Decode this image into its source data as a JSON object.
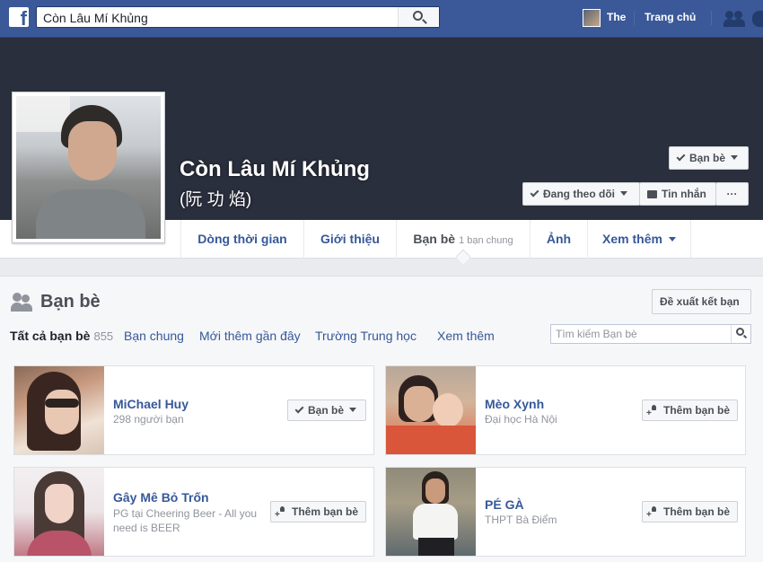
{
  "topbar": {
    "search_value": "Còn Lâu Mí Khủng",
    "user_name": "The",
    "home_label": "Trang chủ"
  },
  "profile": {
    "name": "Còn Lâu Mí Khủng",
    "alternate_name": "(阮 功 焰)",
    "friend_button": "Bạn bè",
    "following_button": "Đang theo dõi",
    "message_button": "Tin nhắn",
    "more_button": "···"
  },
  "tabs": [
    {
      "label": "Dòng thời gian"
    },
    {
      "label": "Giới thiệu"
    },
    {
      "label": "Bạn bè",
      "sub": "1 bạn chung"
    },
    {
      "label": "Ảnh"
    },
    {
      "label": "Xem thêm"
    }
  ],
  "friends_panel": {
    "title": "Bạn bè",
    "suggest_button": "Đề xuất kết bạn",
    "subnav": [
      {
        "label": "Tất cả bạn bè",
        "count": "855"
      },
      {
        "label": "Bạn chung"
      },
      {
        "label": "Mới thêm gần đây"
      },
      {
        "label": "Trường Trung học"
      },
      {
        "label": "Xem thêm"
      }
    ],
    "search_placeholder": "Tìm kiếm Bạn bè",
    "cards": [
      {
        "name": "MiChael Huy",
        "meta": "298 người bạn",
        "button": "Bạn bè"
      },
      {
        "name": "Mèo Xynh",
        "meta": "Đại học Hà Nội",
        "button": "Thêm bạn bè"
      },
      {
        "name": "Gây Mê Bỏ Trốn",
        "meta": "PG tại Cheering Beer - All you need is BEER",
        "button": "Thêm bạn bè"
      },
      {
        "name": "PÉ GÀ",
        "meta": "THPT Bà Điểm",
        "button": "Thêm bạn bè"
      }
    ]
  },
  "colors": {
    "brand_blue": "#3b5998",
    "link_blue": "#365899",
    "cover_dark": "#2a2f3d"
  }
}
